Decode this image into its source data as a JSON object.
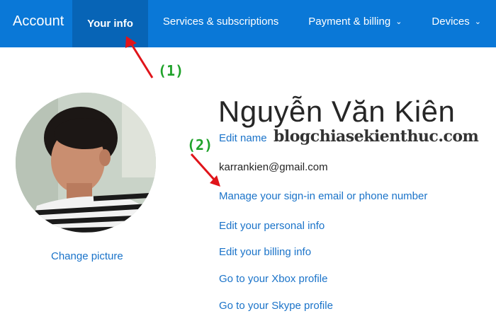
{
  "nav": {
    "brand": "Account",
    "items": [
      {
        "label": "Your info",
        "active": true
      },
      {
        "label": "Services & subscriptions",
        "active": false
      },
      {
        "label": "Payment & billing",
        "active": false,
        "dropdown": true
      },
      {
        "label": "Devices",
        "active": false,
        "dropdown": true
      }
    ],
    "chevron": "⌄"
  },
  "profile": {
    "name": "Nguyễn Văn Kiên",
    "edit_name": "Edit name",
    "email": "karrankien@gmail.com",
    "change_picture": "Change picture",
    "links": [
      "Manage your sign-in email or phone number",
      "Edit your personal info",
      "Edit your billing info",
      "Go to your Xbox profile",
      "Go to your Skype profile"
    ]
  },
  "watermark": "blogchiasekienthuc.com",
  "annotations": {
    "step1": "(1)",
    "step2": "(2)"
  },
  "colors": {
    "nav_bg": "#0a78d7",
    "nav_active_bg": "#0764b6",
    "link": "#1a73c9",
    "annotation_text": "#1fa22a",
    "arrow": "#e0141a"
  },
  "icons": {
    "dropdown": "chevron-down-icon",
    "arrow": "red-arrow-icon"
  }
}
